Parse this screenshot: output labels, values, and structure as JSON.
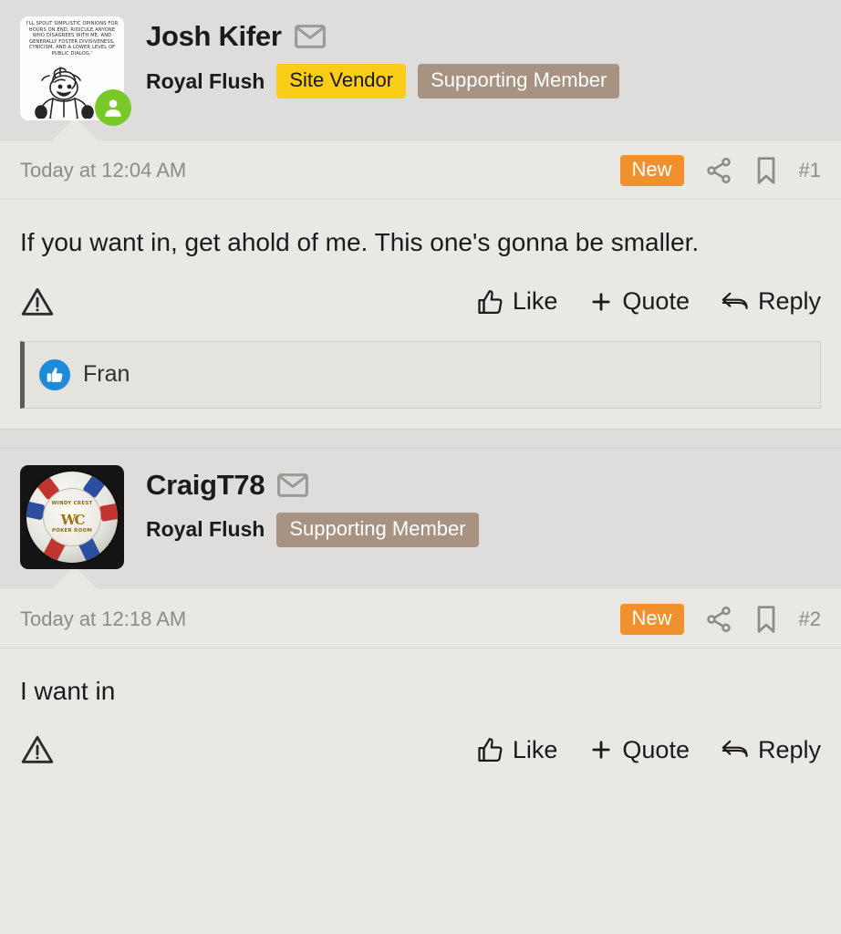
{
  "posts": [
    {
      "user": {
        "name": "Josh Kifer",
        "title": "Royal Flush",
        "badges": [
          {
            "label": "Site Vendor",
            "color": "#fbcc18",
            "text_color": "#181818"
          },
          {
            "label": "Supporting Member",
            "color": "#a89382",
            "text_color": "#ffffff"
          }
        ],
        "online": true,
        "avatar_type": "cartoon",
        "avatar_caption": "I'll spout simplistic opinions for hours on end, ridicule anyone who disagrees with me, and generally foster divisiveness, cynicism, and a lower level of public dialog.'"
      },
      "date": "Today at 12:04 AM",
      "new_label": "New",
      "number": "#1",
      "body": "If you want in, get ahold of me. This one's gonna be smaller.",
      "actions": {
        "like": "Like",
        "quote": "Quote",
        "reply": "Reply"
      },
      "likes": {
        "names": "Fran"
      }
    },
    {
      "user": {
        "name": "CraigT78",
        "title": "Royal Flush",
        "badges": [
          {
            "label": "Supporting Member",
            "color": "#a89382",
            "text_color": "#ffffff"
          }
        ],
        "online": false,
        "avatar_type": "poker-chip",
        "chip_top_text": "WINDY CREST",
        "chip_bottom_text": "POKER ROOM",
        "chip_monogram": "WC"
      },
      "date": "Today at 12:18 AM",
      "new_label": "New",
      "number": "#2",
      "body": "I want in",
      "actions": {
        "like": "Like",
        "quote": "Quote",
        "reply": "Reply"
      },
      "likes": null
    }
  ],
  "icons": {
    "envelope": "envelope-icon",
    "share": "share-icon",
    "bookmark": "bookmark-icon",
    "report": "warning-triangle-icon",
    "thumbs_up": "thumbs-up-icon",
    "plus": "plus-icon",
    "reply_arrow": "reply-arrow-icon"
  },
  "colors": {
    "page_bg": "#e9e8e4",
    "header_bg": "#dedddb",
    "new_badge": "#f0912d",
    "vendor_badge": "#fbcc18",
    "support_badge": "#a89382",
    "online": "#7ac729",
    "like_blue": "#1d8bd8"
  }
}
